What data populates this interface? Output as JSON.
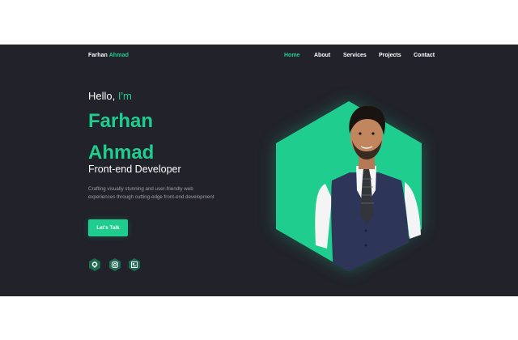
{
  "header": {
    "logo_first": "Farhan",
    "logo_last": "Ahmad",
    "nav": [
      {
        "label": "Home",
        "active": true
      },
      {
        "label": "About",
        "active": false
      },
      {
        "label": "Services",
        "active": false
      },
      {
        "label": "Projects",
        "active": false
      },
      {
        "label": "Contact",
        "active": false
      }
    ]
  },
  "hero": {
    "greeting": "Hello,",
    "greeting_accent": "I'm",
    "name_line1": "Farhan",
    "name_line2": "Ahmad",
    "role": "Front-end Developer",
    "description": "Crafting visually stunning and user-friendly web experiences through cutting-edge front-end development",
    "cta_label": "Let's Talk"
  },
  "socials": [
    {
      "icon": "github-icon"
    },
    {
      "icon": "instagram-icon"
    },
    {
      "icon": "portfolio-icon"
    }
  ],
  "colors": {
    "accent": "#1fce8f",
    "background": "#21222a",
    "text": "#ffffff",
    "muted": "#9aa0a8"
  }
}
